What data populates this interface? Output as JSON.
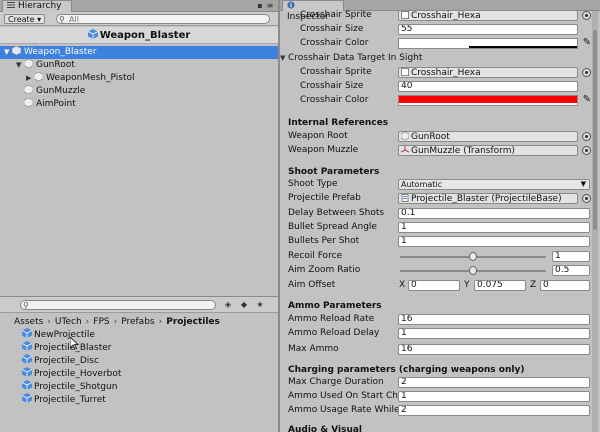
{
  "hierarchy": {
    "tab_label": "Hierarchy",
    "create_label": "Create",
    "search_placeholder": "All",
    "scene_name": "Weapon_Blaster",
    "items": [
      {
        "label": "Weapon_Blaster",
        "depth": 0,
        "selected": true,
        "expanded": true
      },
      {
        "label": "GunRoot",
        "depth": 1,
        "selected": false,
        "expanded": true
      },
      {
        "label": "WeaponMesh_Pistol",
        "depth": 2,
        "selected": false,
        "expanded": false
      },
      {
        "label": "GunMuzzle",
        "depth": 1,
        "selected": false
      },
      {
        "label": "AimPoint",
        "depth": 1,
        "selected": false
      }
    ]
  },
  "project": {
    "breadcrumb": [
      "Assets",
      "UTech",
      "FPS",
      "Prefabs",
      "Projectiles"
    ],
    "items": [
      "NewProjectile",
      "Projectile_Blaster",
      "Projectile_Disc",
      "Projectile_Hoverbot",
      "Projectile_Shotgun",
      "Projectile_Turret"
    ]
  },
  "inspector": {
    "tab_label": "Inspector",
    "crosshair_default": {
      "sprite_label": "Crosshair Sprite",
      "sprite_value": "Crosshair_Hexa",
      "size_label": "Crosshair Size",
      "size_value": "55",
      "color_label": "Crosshair Color",
      "color_hex": "#ffffff"
    },
    "crosshair_target": {
      "header": "Crosshair Data Target In Sight",
      "sprite_label": "Crosshair Sprite",
      "sprite_value": "Crosshair_Hexa",
      "size_label": "Crosshair Size",
      "size_value": "40",
      "color_label": "Crosshair Color",
      "color_hex": "#ff0000"
    },
    "internal": {
      "header": "Internal References",
      "weapon_root_label": "Weapon Root",
      "weapon_root_value": "GunRoot",
      "weapon_muzzle_label": "Weapon Muzzle",
      "weapon_muzzle_value": "GunMuzzle (Transform)"
    },
    "shoot": {
      "header": "Shoot Parameters",
      "shoot_type_label": "Shoot Type",
      "shoot_type_value": "Automatic",
      "prefab_label": "Projectile Prefab",
      "prefab_value": "Projectile_Blaster (ProjectileBase)",
      "delay_label": "Delay Between Shots",
      "delay_value": "0.1",
      "spread_label": "Bullet Spread Angle",
      "spread_value": "1",
      "per_shot_label": "Bullets Per Shot",
      "per_shot_value": "1",
      "recoil_label": "Recoil Force",
      "recoil_value": "1",
      "recoil_fraction": 0.5,
      "zoom_label": "Aim Zoom Ratio",
      "zoom_value": "0.5",
      "zoom_fraction": 0.5,
      "offset_label": "Aim Offset",
      "offset_x_label": "X",
      "offset_x": "0",
      "offset_y_label": "Y",
      "offset_y": "0.075",
      "offset_z_label": "Z",
      "offset_z": "0"
    },
    "ammo": {
      "header": "Ammo Parameters",
      "reload_rate_label": "Ammo Reload Rate",
      "reload_rate_value": "16",
      "reload_delay_label": "Ammo Reload Delay",
      "reload_delay_value": "1",
      "max_label": "Max Ammo",
      "max_value": "16"
    },
    "charging": {
      "header": "Charging parameters (charging weapons only)",
      "max_charge_label": "Max Charge Duration",
      "max_charge_value": "2",
      "used_label": "Ammo Used On Start Ch",
      "used_value": "1",
      "usage_label": "Ammo Usage Rate While",
      "usage_value": "2"
    },
    "next_header": "Audio & Visual"
  }
}
